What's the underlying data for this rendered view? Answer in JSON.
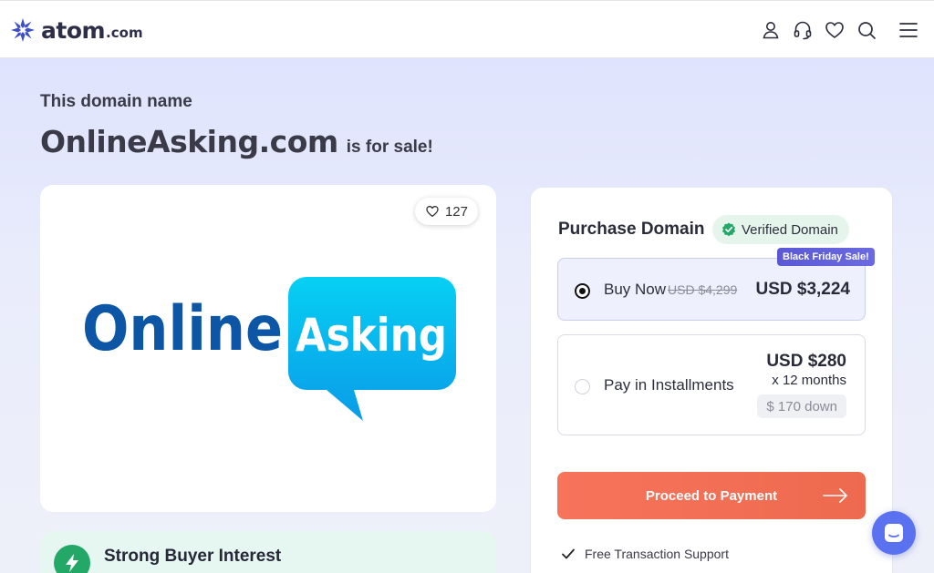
{
  "header": {
    "logo_text": "atom",
    "logo_tld": ".com",
    "icons": [
      "user-icon",
      "headset-icon",
      "heart-icon",
      "search-icon",
      "menu-icon"
    ]
  },
  "hero": {
    "eyebrow": "This domain name",
    "domain": "OnlineAsking.com",
    "suffix": "is for sale!"
  },
  "logo_card": {
    "likes": "127",
    "brand_word_1": "Online",
    "brand_word_2": "Asking"
  },
  "interest": {
    "title": "Strong Buyer Interest"
  },
  "purchase": {
    "title": "Purchase Domain",
    "verified_label": "Verified Domain",
    "sale_tag": "Black Friday Sale!",
    "buy_now": {
      "label": "Buy Now",
      "old_price": "USD $4,299",
      "price": "USD $3,224",
      "selected": true
    },
    "installments": {
      "label": "Pay in Installments",
      "price": "USD $280",
      "months": "x 12 months",
      "down": "$ 170 down",
      "selected": false
    },
    "proceed_label": "Proceed to Payment",
    "support_label": "Free Transaction Support"
  },
  "colors": {
    "accent_orange": "#f06d52",
    "brand_navy": "#2d2e47",
    "verified_green": "#24a868",
    "sale_purple": "#5a58d6",
    "chat_blue": "#5b72f0"
  }
}
